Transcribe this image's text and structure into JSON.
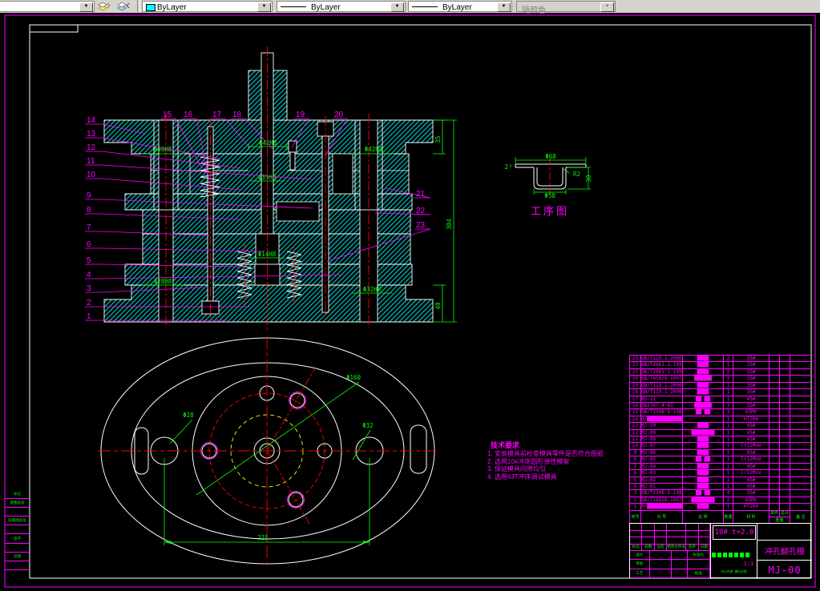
{
  "toolbar": {
    "color_combo": {
      "value": "ByLayer",
      "swatch": "#00ffff"
    },
    "linetype_combo": {
      "value": "ByLayer"
    },
    "lineweight_combo": {
      "value": "ByLayer"
    },
    "plotstyle_combo": {
      "value": "随颜色",
      "disabled": true
    }
  },
  "colors": {
    "accent_magenta": "#ff00ff",
    "dim_green": "#00ff00",
    "hatch_cyan": "#00ffff",
    "centerline_red": "#ff0000",
    "outline_white": "#ffffff"
  },
  "section_view": {
    "callouts_left": [
      "14",
      "13",
      "12",
      "11",
      "10",
      "9",
      "8",
      "7",
      "6",
      "5",
      "4",
      "3",
      "2",
      "1"
    ],
    "callouts_top": [
      "15",
      "16",
      "17",
      "18",
      "19",
      "20"
    ],
    "callouts_right": [
      "21",
      "22",
      "23"
    ],
    "dims": [
      "Φ42H8",
      "Φ40H8",
      "Φ42H8",
      "Φ35H8",
      "Φ14H8",
      "Φ28H8",
      "Φ32H8",
      "35",
      "304",
      "40"
    ]
  },
  "process_view": {
    "title": "工序图",
    "dim_top": "Φ68",
    "dim_bottom": "Φ58",
    "dim_right": "30",
    "dim_radius": "R2",
    "dim_thickness": "2"
  },
  "plan_view": {
    "dim_bolt_circle": "Φ160",
    "dim_left_hole": "Φ28",
    "dim_right_hole": "Φ32",
    "dim_span": "215"
  },
  "tech_notes": {
    "title": "技术要求",
    "items": [
      "1. 安装模具前检查模具零件是否符合图纸",
      "2. 选用10#冲床圆形弹性模架",
      "3. 保证模具间隙均匀",
      "4. 选用63T冲床调试模具"
    ]
  },
  "bom": {
    "headers": [
      "序号",
      "代 号",
      "名 称",
      "数量",
      "材 料",
      "单件",
      "总计",
      "重量",
      "备 注"
    ],
    "rows": [
      {
        "no": "23",
        "code": "GB/T119.1-2000",
        "name": "████",
        "qty": "2",
        "mat": "35#"
      },
      {
        "no": "22",
        "code": "GB/T2861.1-1990",
        "name": "████",
        "qty": "1",
        "mat": "25#"
      },
      {
        "no": "21",
        "code": "GB/T2861.1-1990",
        "name": "████",
        "qty": "2",
        "mat": "25#"
      },
      {
        "no": "20",
        "code": "GB/T65828-1997",
        "name": "██████",
        "qty": "3",
        "mat": "35#"
      },
      {
        "no": "19",
        "code": "GB/T119.1-2000",
        "name": "████",
        "qty": "1",
        "mat": "35#"
      },
      {
        "no": "18",
        "code": "GB/T119.1-2000",
        "name": "████",
        "qty": "1",
        "mat": "35#"
      },
      {
        "no": "17",
        "code": "MJ-11",
        "name": "██ ██",
        "qty": "1",
        "mat": "45#"
      },
      {
        "no": "16",
        "code": "GB2347.4-81",
        "name": "██████",
        "qty": "3",
        "mat": "35#"
      },
      {
        "no": "15",
        "code": "GB/T2348.5-1988",
        "name": "██ ██",
        "qty": "3",
        "mat": "65Mn"
      },
      {
        "no": "14",
        "code": "0/█████████████",
        "name": "",
        "qty": "1",
        "mat": "HT200"
      },
      {
        "no": "13",
        "code": "MJ-10",
        "name": "████",
        "qty": "1",
        "mat": "45#"
      },
      {
        "no": "12",
        "code": "MJ-09",
        "name": "████████",
        "qty": "1",
        "mat": "45#"
      },
      {
        "no": "11",
        "code": "MJ-08",
        "name": "████",
        "qty": "1",
        "mat": "45#"
      },
      {
        "no": "10",
        "code": "MJ-07",
        "name": "████",
        "qty": "1",
        "mat": "Cr12MoV"
      },
      {
        "no": "9",
        "code": "MJ-06",
        "name": "████",
        "qty": "1",
        "mat": "45#"
      },
      {
        "no": "8",
        "code": "MJ-05",
        "name": "██ ██",
        "qty": "1",
        "mat": "Cr12MoV"
      },
      {
        "no": "7",
        "code": "MJ-04",
        "name": "████",
        "qty": "1",
        "mat": "45#"
      },
      {
        "no": "6",
        "code": "MJ-03",
        "name": "████",
        "qty": "1",
        "mat": "Cr12MoV"
      },
      {
        "no": "5",
        "code": "MJ-02",
        "name": "████",
        "qty": "1",
        "mat": "45#"
      },
      {
        "no": "4",
        "code": "MJ-01",
        "name": "████",
        "qty": "1",
        "mat": "45#"
      },
      {
        "no": "3",
        "code": "GB/T2348.5-1988",
        "name": "██ ██",
        "qty": "4",
        "mat": "35#"
      },
      {
        "no": "2",
        "code": "GB/T16928-1997",
        "name": "████████",
        "qty": "2",
        "mat": "65Mn"
      },
      {
        "no": "1",
        "code": "0/█████████████",
        "name": "████",
        "qty": "1",
        "mat": "HT200"
      }
    ]
  },
  "title_block": {
    "material_spec": "10#  t=2.0",
    "part_name": "冲孔翻孔模",
    "drawing_no": "MJ-00",
    "scale": "1:1",
    "sheet_info": "共14张 第01张",
    "sig_labels": [
      "标记",
      "处数",
      "分区",
      "更改文件号",
      "签字",
      "日期"
    ],
    "low_labels": [
      "设计",
      "标准化",
      "审核",
      "工艺",
      "批准"
    ]
  },
  "left_strip": {
    "rows": [
      "标记",
      "底图总号",
      "",
      "旧底图总号",
      "",
      "签字",
      "",
      "日期",
      ""
    ]
  }
}
